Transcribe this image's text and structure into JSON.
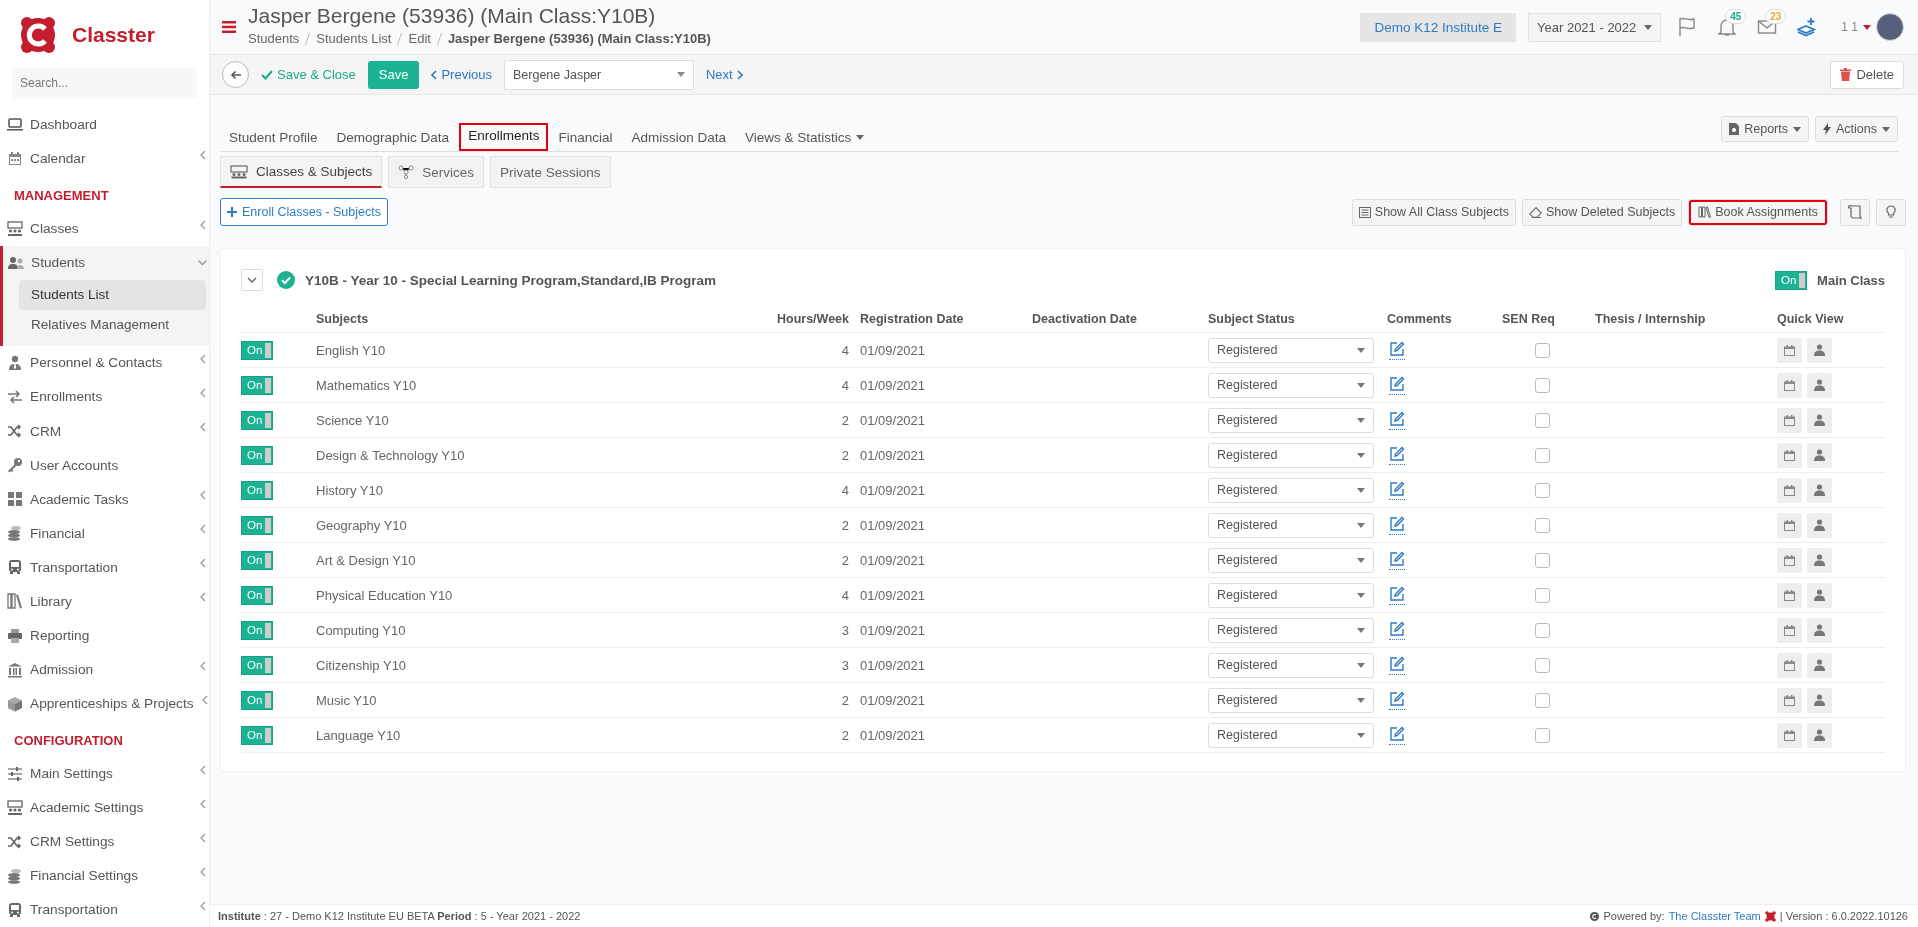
{
  "sidebar": {
    "brand": "Classter",
    "search": {
      "placeholder": "Search..."
    },
    "items": [
      {
        "kind": "item",
        "label": "Dashboard",
        "expandable": false,
        "expanded": false
      },
      {
        "kind": "item",
        "label": "Calendar",
        "expandable": true,
        "expanded": false
      },
      {
        "kind": "heading",
        "label": "MANAGEMENT"
      },
      {
        "kind": "item",
        "label": "Classes",
        "expandable": true,
        "expanded": false
      },
      {
        "kind": "item",
        "label": "Students",
        "expandable": true,
        "expanded": true,
        "children": [
          {
            "label": "Students List",
            "selected": true
          },
          {
            "label": "Relatives Management",
            "selected": false
          }
        ]
      },
      {
        "kind": "item",
        "label": "Personnel & Contacts",
        "expandable": true,
        "expanded": false
      },
      {
        "kind": "item",
        "label": "Enrollments",
        "expandable": true,
        "expanded": false
      },
      {
        "kind": "item",
        "label": "CRM",
        "expandable": true,
        "expanded": false
      },
      {
        "kind": "item",
        "label": "User Accounts",
        "expandable": false,
        "expanded": false
      },
      {
        "kind": "item",
        "label": "Academic Tasks",
        "expandable": true,
        "expanded": false
      },
      {
        "kind": "item",
        "label": "Financial",
        "expandable": true,
        "expanded": false
      },
      {
        "kind": "item",
        "label": "Transportation",
        "expandable": true,
        "expanded": false
      },
      {
        "kind": "item",
        "label": "Library",
        "expandable": true,
        "expanded": false
      },
      {
        "kind": "item",
        "label": "Reporting",
        "expandable": false,
        "expanded": false
      },
      {
        "kind": "item",
        "label": "Admission",
        "expandable": true,
        "expanded": false
      },
      {
        "kind": "item",
        "label": "Apprenticeships & Projects",
        "expandable": true,
        "expanded": false
      },
      {
        "kind": "heading",
        "label": "CONFIGURATION"
      },
      {
        "kind": "item",
        "label": "Main Settings",
        "expandable": true,
        "expanded": false
      },
      {
        "kind": "item",
        "label": "Academic Settings",
        "expandable": true,
        "expanded": false
      },
      {
        "kind": "item",
        "label": "CRM Settings",
        "expandable": true,
        "expanded": false
      },
      {
        "kind": "item",
        "label": "Financial Settings",
        "expandable": true,
        "expanded": false
      },
      {
        "kind": "item",
        "label": "Transportation",
        "expandable": true,
        "expanded": false
      }
    ]
  },
  "header": {
    "title": "Jasper Bergene (53936) (Main Class:Y10B)",
    "breadcrumbs": [
      "Students",
      "Students List",
      "Edit",
      "Jasper Bergene (53936) (Main Class:Y10B)"
    ],
    "institute": "Demo K12 Institute E",
    "year": "Year 2021 - 2022",
    "notifications": "45",
    "messages": "23",
    "user": "1 1"
  },
  "toolbar": {
    "save_close": "Save & Close",
    "save": "Save",
    "previous": "Previous",
    "student_select": "Bergene Jasper",
    "next": "Next",
    "delete": "Delete"
  },
  "tabs": [
    {
      "label": "Student Profile",
      "selected": false,
      "highlighted": false,
      "dropdown": false
    },
    {
      "label": "Demographic Data",
      "selected": false,
      "highlighted": false,
      "dropdown": false
    },
    {
      "label": "Enrollments",
      "selected": true,
      "highlighted": true,
      "dropdown": false
    },
    {
      "label": "Financial",
      "selected": false,
      "highlighted": false,
      "dropdown": false
    },
    {
      "label": "Admission Data",
      "selected": false,
      "highlighted": false,
      "dropdown": false
    },
    {
      "label": "Views & Statistics",
      "selected": false,
      "highlighted": false,
      "dropdown": true
    }
  ],
  "tab_actions": [
    "Reports",
    "Actions"
  ],
  "subtabs": [
    {
      "label": "Classes & Subjects",
      "selected": true
    },
    {
      "label": "Services",
      "selected": false
    },
    {
      "label": "Private Sessions",
      "selected": false
    }
  ],
  "enroll_button": "Enroll Classes - Subjects",
  "subject_tools": [
    {
      "label": "Show All Class Subjects",
      "highlighted": false
    },
    {
      "label": "Show Deleted Subjects",
      "highlighted": false
    },
    {
      "label": "Book Assignments",
      "highlighted": true
    }
  ],
  "class_group": {
    "title": "Y10B - Year 10 - Special Learning Program,Standard,IB Program",
    "expanded": true,
    "main_class": {
      "text": "On",
      "on": true,
      "label": "Main Class"
    },
    "columns": [
      "Subjects",
      "Hours/Week",
      "Registration Date",
      "Deactivation Date",
      "Subject Status",
      "Comments",
      "SEN Req",
      "Thesis / Internship",
      "Quick View"
    ],
    "rows": [
      {
        "switch": {
          "text": "On",
          "on": true
        },
        "subject": "English Y10",
        "hours": "4",
        "registration_date": "01/09/2021",
        "status": "Registered",
        "sen_required": false
      },
      {
        "switch": {
          "text": "On",
          "on": true
        },
        "subject": "Mathematics Y10",
        "hours": "4",
        "registration_date": "01/09/2021",
        "status": "Registered",
        "sen_required": false
      },
      {
        "switch": {
          "text": "On",
          "on": true
        },
        "subject": "Science Y10",
        "hours": "2",
        "registration_date": "01/09/2021",
        "status": "Registered",
        "sen_required": false
      },
      {
        "switch": {
          "text": "On",
          "on": true
        },
        "subject": "Design & Technology Y10",
        "hours": "2",
        "registration_date": "01/09/2021",
        "status": "Registered",
        "sen_required": false
      },
      {
        "switch": {
          "text": "On",
          "on": true
        },
        "subject": "History Y10",
        "hours": "4",
        "registration_date": "01/09/2021",
        "status": "Registered",
        "sen_required": false
      },
      {
        "switch": {
          "text": "On",
          "on": true
        },
        "subject": "Geography Y10",
        "hours": "2",
        "registration_date": "01/09/2021",
        "status": "Registered",
        "sen_required": false
      },
      {
        "switch": {
          "text": "On",
          "on": true
        },
        "subject": "Art & Design Y10",
        "hours": "2",
        "registration_date": "01/09/2021",
        "status": "Registered",
        "sen_required": false
      },
      {
        "switch": {
          "text": "On",
          "on": true
        },
        "subject": "Physical Education Y10",
        "hours": "4",
        "registration_date": "01/09/2021",
        "status": "Registered",
        "sen_required": false
      },
      {
        "switch": {
          "text": "On",
          "on": true
        },
        "subject": "Computing Y10",
        "hours": "3",
        "registration_date": "01/09/2021",
        "status": "Registered",
        "sen_required": false
      },
      {
        "switch": {
          "text": "On",
          "on": true
        },
        "subject": "Citizenship Y10",
        "hours": "3",
        "registration_date": "01/09/2021",
        "status": "Registered",
        "sen_required": false
      },
      {
        "switch": {
          "text": "On",
          "on": true
        },
        "subject": "Music Y10",
        "hours": "2",
        "registration_date": "01/09/2021",
        "status": "Registered",
        "sen_required": false
      },
      {
        "switch": {
          "text": "On",
          "on": true
        },
        "subject": "Language Y10",
        "hours": "2",
        "registration_date": "01/09/2021",
        "status": "Registered",
        "sen_required": false
      }
    ]
  },
  "footer": {
    "info": "**Institute** : 27 - Demo K12 Institute EU BETA **Period** : 5 - Year 2021 - 2022",
    "powered_by": "Powered by:",
    "team_link": "The Classter Team",
    "version": "| Version : 6.0.2022.10126"
  }
}
